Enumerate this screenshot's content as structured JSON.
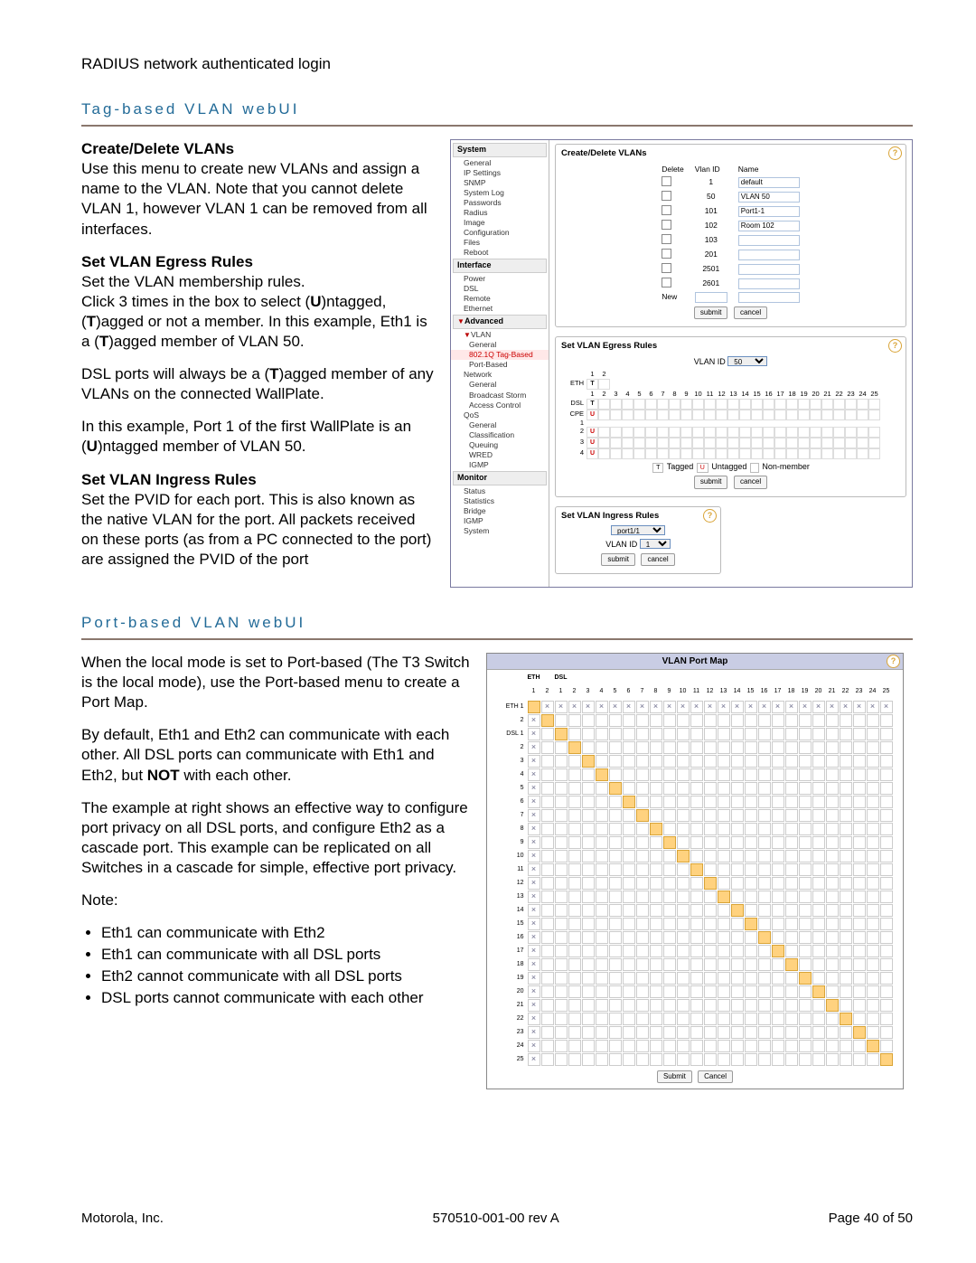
{
  "header": {
    "title": "RADIUS network authenticated login"
  },
  "section_tag": {
    "title": "Tag-based VLAN webUI",
    "create_heading": "Create/Delete VLANs",
    "create_body": "Use this menu to create new VLANs and assign a name to the VLAN.  Note that you cannot delete VLAN 1, however VLAN 1 can be removed from all interfaces.",
    "egress_heading": "Set VLAN Egress Rules",
    "egress_body_1": "Set the VLAN membership rules.",
    "egress_body_2a": "Click 3 times in the box to select (",
    "egress_body_2b": ")ntagged, (",
    "egress_body_2c": ")agged or not a member.  In this example, Eth1 is a (",
    "egress_body_2d": ")agged member of VLAN 50.",
    "egress_body_3a": "DSL ports will always be a (",
    "egress_body_3b": ")agged member of any VLANs on the connected WallPlate.",
    "egress_body_4a": "In this example, Port 1 of the first WallPlate is an (",
    "egress_body_4b": ")ntagged member of VLAN 50.",
    "ingress_heading": "Set VLAN Ingress Rules",
    "ingress_body": "Set the PVID for each port.  This is also known as the native VLAN for the port.  All packets received on these ports (as from a PC connected to the port) are assigned the PVID of the port",
    "U": "U",
    "T": "T"
  },
  "section_port": {
    "title": "Port-based VLAN webUI",
    "body_1": "When the local mode is set to Port-based (The T3 Switch is the local mode), use the Port-based menu to create a Port Map.",
    "body_2a": "By default, Eth1 and Eth2 can communicate with each other.  All DSL ports can communicate with Eth1 and Eth2, but ",
    "body_2_not": "NOT",
    "body_2b": " with each other.",
    "body_3": "The example at right shows an effective way to configure port privacy on all DSL ports, and configure Eth2 as a cascade port.  This example can be replicated on all Switches in a cascade for simple, effective port privacy.",
    "note_label": "Note:",
    "bullets": [
      "Eth1 can communicate with Eth2",
      "Eth1 can communicate with all DSL ports",
      "Eth2 cannot communicate with all DSL ports",
      "DSL ports cannot communicate with each other"
    ]
  },
  "tag_panel": {
    "tree_groups": {
      "system": "System",
      "system_items": [
        "General",
        "IP Settings",
        "SNMP",
        "System Log",
        "Passwords",
        "Radius",
        "Image",
        "Configuration",
        "Files",
        "Reboot"
      ],
      "interface": "Interface",
      "interface_items": [
        "Power",
        "DSL",
        "Remote",
        "Ethernet"
      ],
      "advanced": "Advanced",
      "vlan_label": "VLAN",
      "vlan_items_pre": [
        "General"
      ],
      "vlan_hot": "802.1Q Tag-Based",
      "vlan_items_post": [
        "Port-Based"
      ],
      "network_label": "Network",
      "network_items": [
        "General",
        "Broadcast Storm",
        "Access Control"
      ],
      "qos_label": "QoS",
      "qos_items": [
        "General",
        "Classification",
        "Queuing",
        "WRED",
        "IGMP"
      ],
      "monitor": "Monitor",
      "monitor_items": [
        "Status",
        "Statistics",
        "Bridge",
        "IGMP",
        "System"
      ]
    },
    "create_panel": {
      "title": "Create/Delete VLANs",
      "col_delete": "Delete",
      "col_vlanid": "Vlan ID",
      "col_name": "Name",
      "rows": [
        {
          "id": "1",
          "name": "default"
        },
        {
          "id": "50",
          "name": "VLAN 50"
        },
        {
          "id": "101",
          "name": "Port1-1"
        },
        {
          "id": "102",
          "name": "Room 102"
        },
        {
          "id": "103",
          "name": ""
        },
        {
          "id": "201",
          "name": ""
        },
        {
          "id": "2501",
          "name": ""
        },
        {
          "id": "2601",
          "name": ""
        }
      ],
      "new_label": "New",
      "submit": "submit",
      "cancel": "cancel"
    },
    "egress_panel": {
      "title": "Set VLAN Egress Rules",
      "vlanid_label": "VLAN ID",
      "vlanid_value": "50",
      "row_eth": "ETH",
      "row_dsl": "DSL",
      "row_cpe": "CPE",
      "legend_t": "T",
      "legend_t_label": "Tagged",
      "legend_u": "U",
      "legend_u_label": "Untagged",
      "legend_nm": "Non-member",
      "submit": "submit",
      "cancel": "cancel"
    },
    "ingress_panel": {
      "title": "Set VLAN Ingress Rules",
      "port_value": "port1/1",
      "vlanid_label": "VLAN ID",
      "vlanid_value": "1",
      "submit": "submit",
      "cancel": "cancel"
    }
  },
  "port_panel": {
    "title": "VLAN Port Map",
    "eth_label": "ETH",
    "dsl_label": "DSL",
    "row_eth_prefix": "ETH",
    "row_dsl_prefix": "DSL",
    "submit": "Submit",
    "cancel": "Cancel"
  },
  "chart_data": {
    "type": "table",
    "description": "VLAN Port Map: which row-port can talk to which column-port (27×27). Columns and rows are ETH1, ETH2, DSL1..DSL25.",
    "columns": [
      "ETH1",
      "ETH2",
      "DSL1",
      "DSL2",
      "DSL3",
      "DSL4",
      "DSL5",
      "DSL6",
      "DSL7",
      "DSL8",
      "DSL9",
      "DSL10",
      "DSL11",
      "DSL12",
      "DSL13",
      "DSL14",
      "DSL15",
      "DSL16",
      "DSL17",
      "DSL18",
      "DSL19",
      "DSL20",
      "DSL21",
      "DSL22",
      "DSL23",
      "DSL24",
      "DSL25"
    ],
    "rows": [
      "ETH1",
      "ETH2",
      "DSL1",
      "DSL2",
      "DSL3",
      "DSL4",
      "DSL5",
      "DSL6",
      "DSL7",
      "DSL8",
      "DSL9",
      "DSL10",
      "DSL11",
      "DSL12",
      "DSL13",
      "DSL14",
      "DSL15",
      "DSL16",
      "DSL17",
      "DSL18",
      "DSL19",
      "DSL20",
      "DSL21",
      "DSL22",
      "DSL23",
      "DSL24",
      "DSL25"
    ],
    "on": {
      "ETH1": [
        "ETH2",
        "DSL1",
        "DSL2",
        "DSL3",
        "DSL4",
        "DSL5",
        "DSL6",
        "DSL7",
        "DSL8",
        "DSL9",
        "DSL10",
        "DSL11",
        "DSL12",
        "DSL13",
        "DSL14",
        "DSL15",
        "DSL16",
        "DSL17",
        "DSL18",
        "DSL19",
        "DSL20",
        "DSL21",
        "DSL22",
        "DSL23",
        "DSL24",
        "DSL25"
      ],
      "ETH2": [
        "ETH1"
      ],
      "DSL1": [
        "ETH1"
      ],
      "DSL2": [
        "ETH1"
      ],
      "DSL3": [
        "ETH1"
      ],
      "DSL4": [
        "ETH1"
      ],
      "DSL5": [
        "ETH1"
      ],
      "DSL6": [
        "ETH1"
      ],
      "DSL7": [
        "ETH1"
      ],
      "DSL8": [
        "ETH1"
      ],
      "DSL9": [
        "ETH1"
      ],
      "DSL10": [
        "ETH1"
      ],
      "DSL11": [
        "ETH1"
      ],
      "DSL12": [
        "ETH1"
      ],
      "DSL13": [
        "ETH1"
      ],
      "DSL14": [
        "ETH1"
      ],
      "DSL15": [
        "ETH1"
      ],
      "DSL16": [
        "ETH1"
      ],
      "DSL17": [
        "ETH1"
      ],
      "DSL18": [
        "ETH1"
      ],
      "DSL19": [
        "ETH1"
      ],
      "DSL20": [
        "ETH1"
      ],
      "DSL21": [
        "ETH1"
      ],
      "DSL22": [
        "ETH1"
      ],
      "DSL23": [
        "ETH1"
      ],
      "DSL24": [
        "ETH1"
      ],
      "DSL25": [
        "ETH1"
      ]
    }
  },
  "egress_data": {
    "eth_cells": [
      "T",
      ""
    ],
    "dsl_cells": [
      "T",
      "",
      "",
      "",
      "",
      "",
      "",
      "",
      "",
      "",
      "",
      "",
      "",
      "",
      "",
      "",
      "",
      "",
      "",
      "",
      "",
      "",
      "",
      "",
      ""
    ],
    "cpe_rows": [
      [
        "U",
        "",
        "",
        "",
        "",
        "",
        "",
        "",
        "",
        "",
        "",
        "",
        "",
        "",
        "",
        "",
        "",
        "",
        "",
        "",
        "",
        "",
        "",
        "",
        ""
      ],
      [
        "U",
        "",
        "",
        "",
        "",
        "",
        "",
        "",
        "",
        "",
        "",
        "",
        "",
        "",
        "",
        "",
        "",
        "",
        "",
        "",
        "",
        "",
        "",
        "",
        ""
      ],
      [
        "U",
        "",
        "",
        "",
        "",
        "",
        "",
        "",
        "",
        "",
        "",
        "",
        "",
        "",
        "",
        "",
        "",
        "",
        "",
        "",
        "",
        "",
        "",
        "",
        ""
      ],
      [
        "U",
        "",
        "",
        "",
        "",
        "",
        "",
        "",
        "",
        "",
        "",
        "",
        "",
        "",
        "",
        "",
        "",
        "",
        "",
        "",
        "",
        "",
        "",
        "",
        ""
      ]
    ]
  },
  "footer": {
    "left": "Motorola, Inc.",
    "center": "570510-001-00 rev A",
    "right": "Page 40 of 50"
  }
}
